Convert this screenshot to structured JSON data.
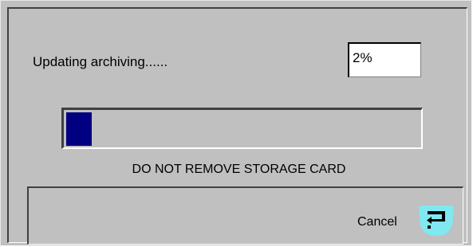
{
  "dialog": {
    "status_text": "Updating archiving......",
    "percent_text": "2%",
    "progress_fraction": 0.02,
    "warning_text": "DO NOT REMOVE STORAGE CARD",
    "cancel_label": "Cancel",
    "cancel_icon": "enter-key-icon"
  },
  "colors": {
    "dialog_bg": "#c0c0c0",
    "progress_fill": "#000080",
    "cancel_key_bg": "#7fe8f0"
  }
}
